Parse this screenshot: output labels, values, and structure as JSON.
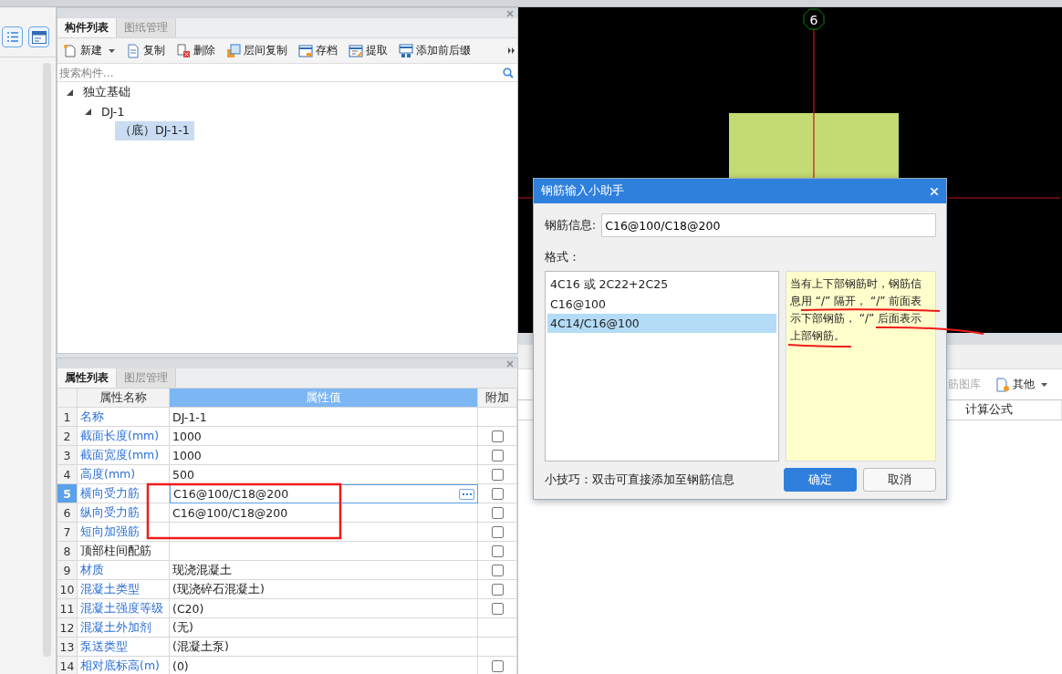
{
  "sidebar": {
    "buttons": [
      {
        "kind": "list"
      },
      {
        "kind": "window"
      }
    ]
  },
  "component_panel": {
    "tabs": [
      {
        "label": "构件列表",
        "selected": true
      },
      {
        "label": "图纸管理",
        "selected": false
      }
    ],
    "toolbar": [
      {
        "label": "新建",
        "kind": "new",
        "dropdown": true
      },
      {
        "label": "复制",
        "kind": "copy",
        "dropdown": false
      },
      {
        "label": "删除",
        "kind": "delete",
        "dropdown": false
      },
      {
        "label": "层间复制",
        "kind": "floor-copy",
        "dropdown": false
      },
      {
        "label": "存档",
        "kind": "archive",
        "dropdown": false
      },
      {
        "label": "提取",
        "kind": "extract",
        "dropdown": false
      },
      {
        "label": "添加前后缀",
        "kind": "affix",
        "dropdown": false
      }
    ],
    "search": {
      "placeholder": "搜索构件..."
    },
    "tree": [
      {
        "label": "独立基础",
        "expanded": true,
        "selected": false,
        "children": [
          {
            "label": "DJ-1",
            "expanded": true,
            "selected": false,
            "children": [
              {
                "label": "（底）DJ-1-1",
                "selected": true
              }
            ]
          }
        ]
      }
    ]
  },
  "property_panel": {
    "tabs": [
      {
        "label": "属性列表",
        "selected": true
      },
      {
        "label": "图层管理",
        "selected": false
      }
    ],
    "columns": [
      "属性名称",
      "属性值",
      "附加"
    ],
    "rows": [
      {
        "index": "1",
        "name": "名称",
        "value": "DJ-1-1",
        "linked": true,
        "selected": false
      },
      {
        "index": "2",
        "name": "截面长度(mm)",
        "value": "1000",
        "linked": true,
        "selected": false,
        "checked": false
      },
      {
        "index": "3",
        "name": "截面宽度(mm)",
        "value": "1000",
        "linked": true,
        "selected": false,
        "checked": false
      },
      {
        "index": "4",
        "name": "高度(mm)",
        "value": "500",
        "linked": true,
        "selected": false,
        "checked": false
      },
      {
        "index": "5",
        "name": "横向受力筋",
        "value": "C16@100/C18@200",
        "linked": true,
        "selected": true,
        "checked": false
      },
      {
        "index": "6",
        "name": "纵向受力筋",
        "value": "C16@100/C18@200",
        "linked": true,
        "selected": false,
        "checked": false
      },
      {
        "index": "7",
        "name": "短向加强筋",
        "linked": true,
        "selected": false,
        "checked": false
      },
      {
        "index": "8",
        "name": "顶部柱间配筋",
        "linked": false,
        "selected": false,
        "checked": false
      },
      {
        "index": "9",
        "name": "材质",
        "value": "现浇混凝土",
        "linked": true,
        "selected": false,
        "checked": false
      },
      {
        "index": "10",
        "name": "混凝土类型",
        "value": "(现浇碎石混凝土)",
        "linked": true,
        "selected": false,
        "checked": false
      },
      {
        "index": "11",
        "name": "混凝土强度等级",
        "value": "(C20)",
        "linked": true,
        "selected": false,
        "checked": false
      },
      {
        "index": "12",
        "name": "混凝土外加剂",
        "value": "(无)",
        "linked": true,
        "selected": false
      },
      {
        "index": "13",
        "name": "泵送类型",
        "value": "(混凝土泵)",
        "linked": true,
        "selected": false
      },
      {
        "index": "14",
        "name": "相对底标高(m)",
        "value": "(0)",
        "linked": true,
        "selected": false,
        "checked": false
      }
    ]
  },
  "canvas": {
    "axis_label": "6"
  },
  "lower_panel": {
    "toolbar": [
      {
        "label": "筋图库",
        "kind": "faded",
        "dropdown": false
      },
      {
        "label": "其他",
        "kind": "other",
        "dropdown": true
      }
    ],
    "columns": [
      "计算公式"
    ]
  },
  "dialog": {
    "title": "钢筋输入小助手",
    "field_label": "钢筋信息:",
    "field_value": "C16@100/C18@200",
    "format_label": "格式：",
    "formats": [
      {
        "label": "4C16 或 2C22+2C25",
        "selected": false
      },
      {
        "label": "C16@100",
        "selected": false
      },
      {
        "label": "4C14/C16@100",
        "selected": true
      }
    ],
    "note": "当有上下部钢筋时，钢筋信息用 “/” 隔开， “/” 前面表示下部钢筋， “/” 后面表示上部钢筋。",
    "tip": "小技巧：双击可直接添加至钢筋信息",
    "buttons": [
      {
        "label": "确定",
        "kind": "primary"
      },
      {
        "label": "取消",
        "kind": "secondary"
      }
    ]
  }
}
